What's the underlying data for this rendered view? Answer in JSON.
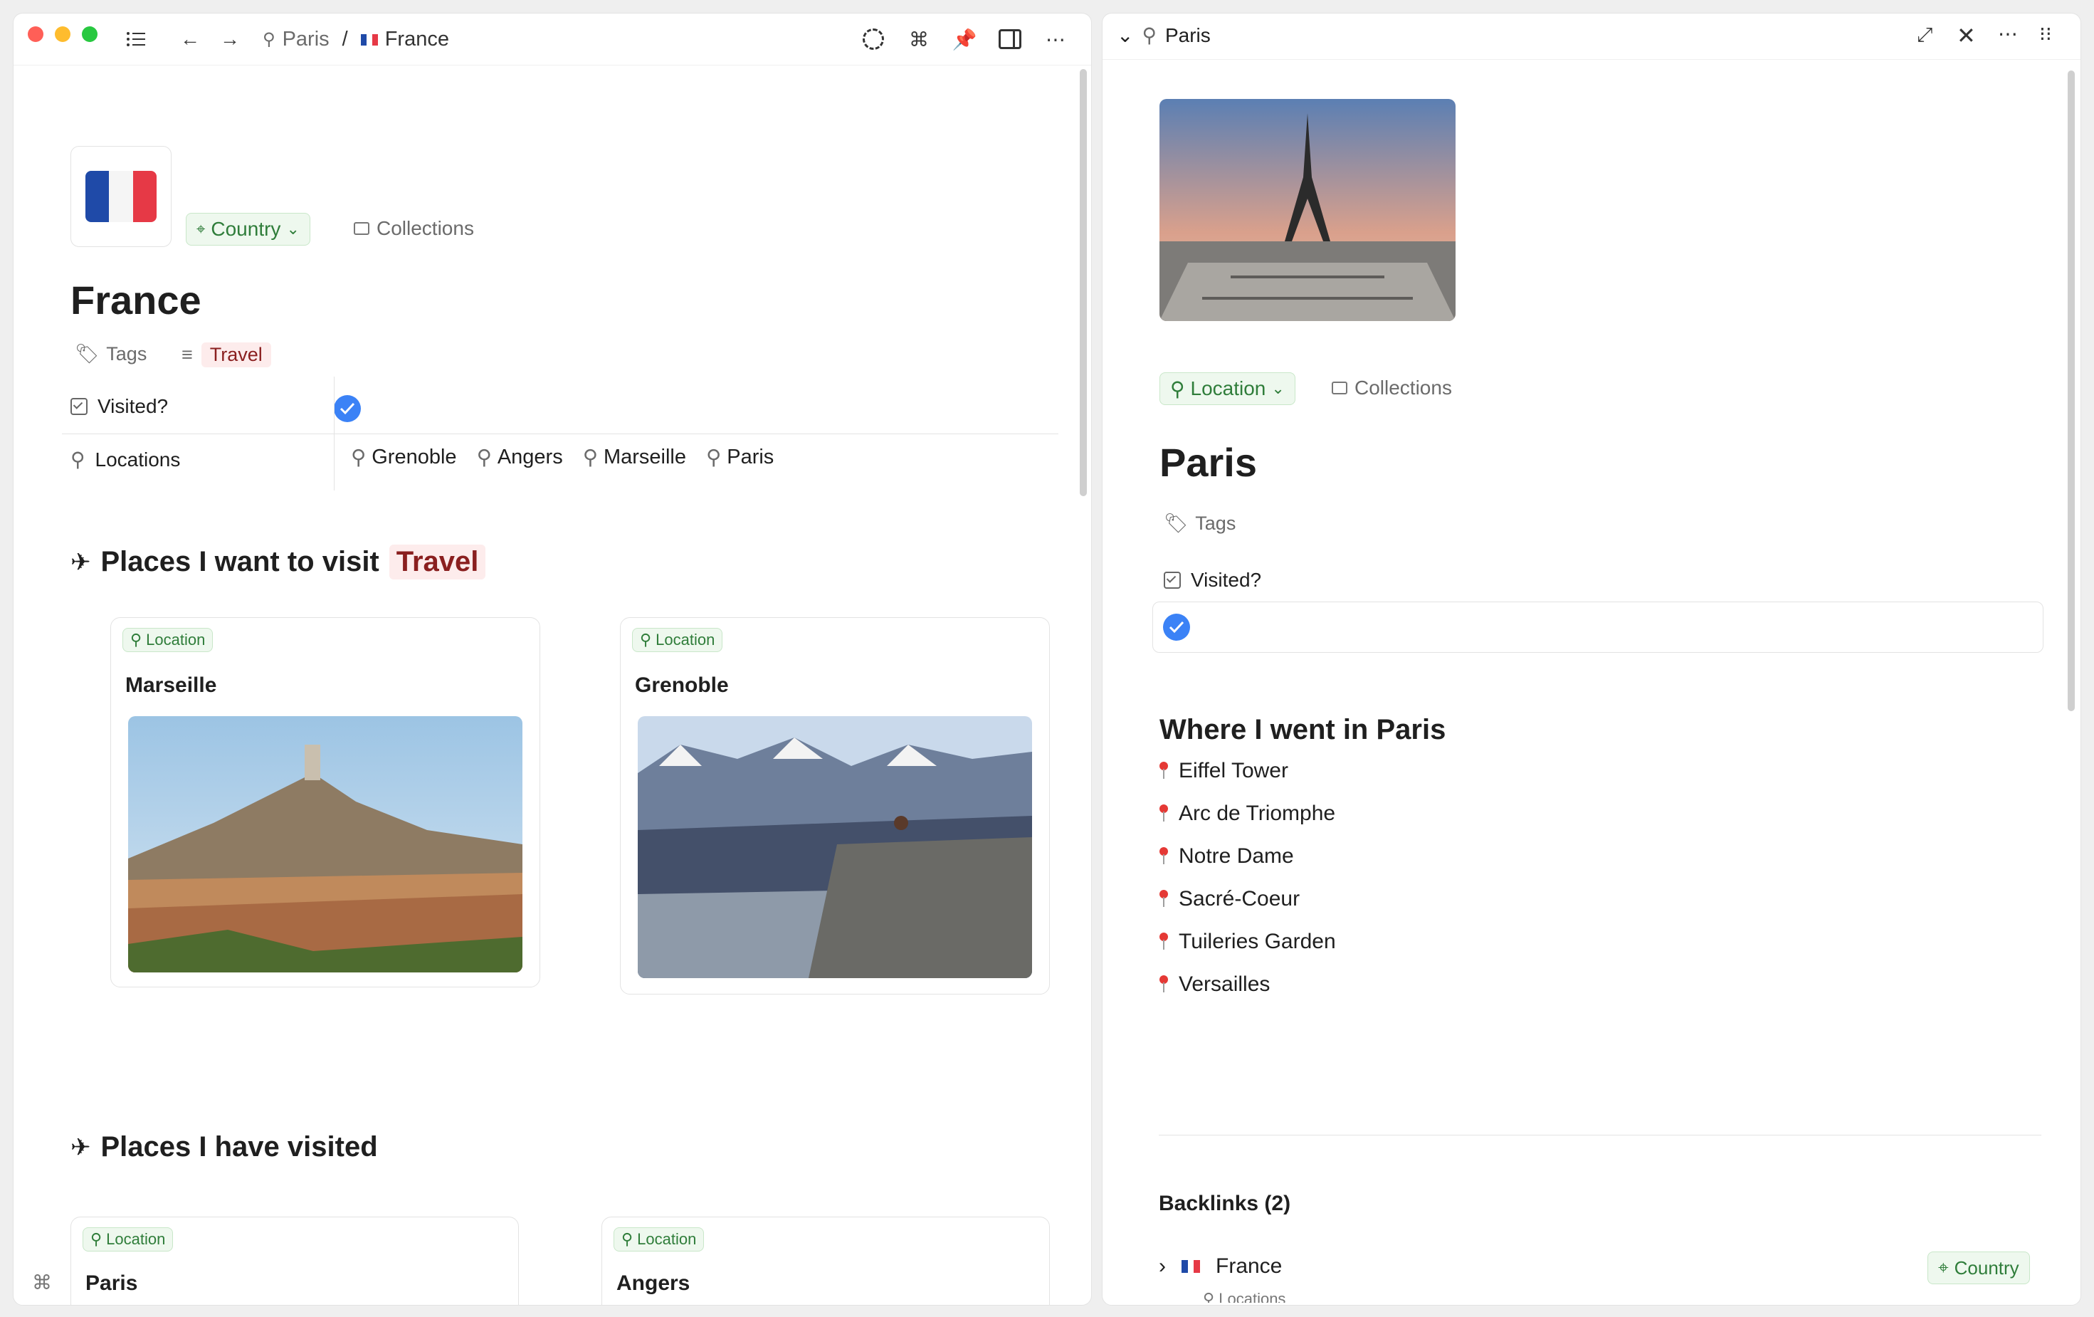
{
  "left": {
    "breadcrumb": [
      {
        "label": "Paris"
      },
      {
        "label": "France"
      }
    ],
    "header": {
      "type_label": "Country",
      "collections_label": "Collections",
      "title": "France"
    },
    "tags": {
      "label": "Tags",
      "tag": "Travel"
    },
    "properties": {
      "visited_label": "Visited?",
      "locations_label": "Locations",
      "locations": [
        "Grenoble",
        "Angers",
        "Marseille",
        "Paris"
      ]
    },
    "section1": {
      "title": "Places I want to visit",
      "tag": "Travel"
    },
    "section2": {
      "title": "Places I have visited"
    },
    "cards_want": [
      {
        "tag": "Location",
        "title": "Marseille"
      },
      {
        "tag": "Location",
        "title": "Grenoble"
      }
    ],
    "cards_visited": [
      {
        "tag": "Location",
        "title": "Paris"
      },
      {
        "tag": "Location",
        "title": "Angers"
      }
    ]
  },
  "right": {
    "title_bar": "Paris",
    "type_label": "Location",
    "collections_label": "Collections",
    "title": "Paris",
    "tags_label": "Tags",
    "visited_label": "Visited?",
    "section_title": "Where I went in Paris",
    "places": [
      "Eiffel Tower",
      "Arc de Triomphe",
      "Notre Dame",
      "Sacré-Coeur",
      "Tuileries Garden",
      "Versailles"
    ],
    "backlinks_title": "Backlinks (2)",
    "backlink": {
      "label": "France",
      "type": "Country",
      "sub": "Locations"
    }
  },
  "colors": {
    "accent_blue": "#3b82f6",
    "green": "#2f7d3a",
    "tag_red": "#8a1f1f",
    "tag_red_bg": "#fdecec"
  }
}
